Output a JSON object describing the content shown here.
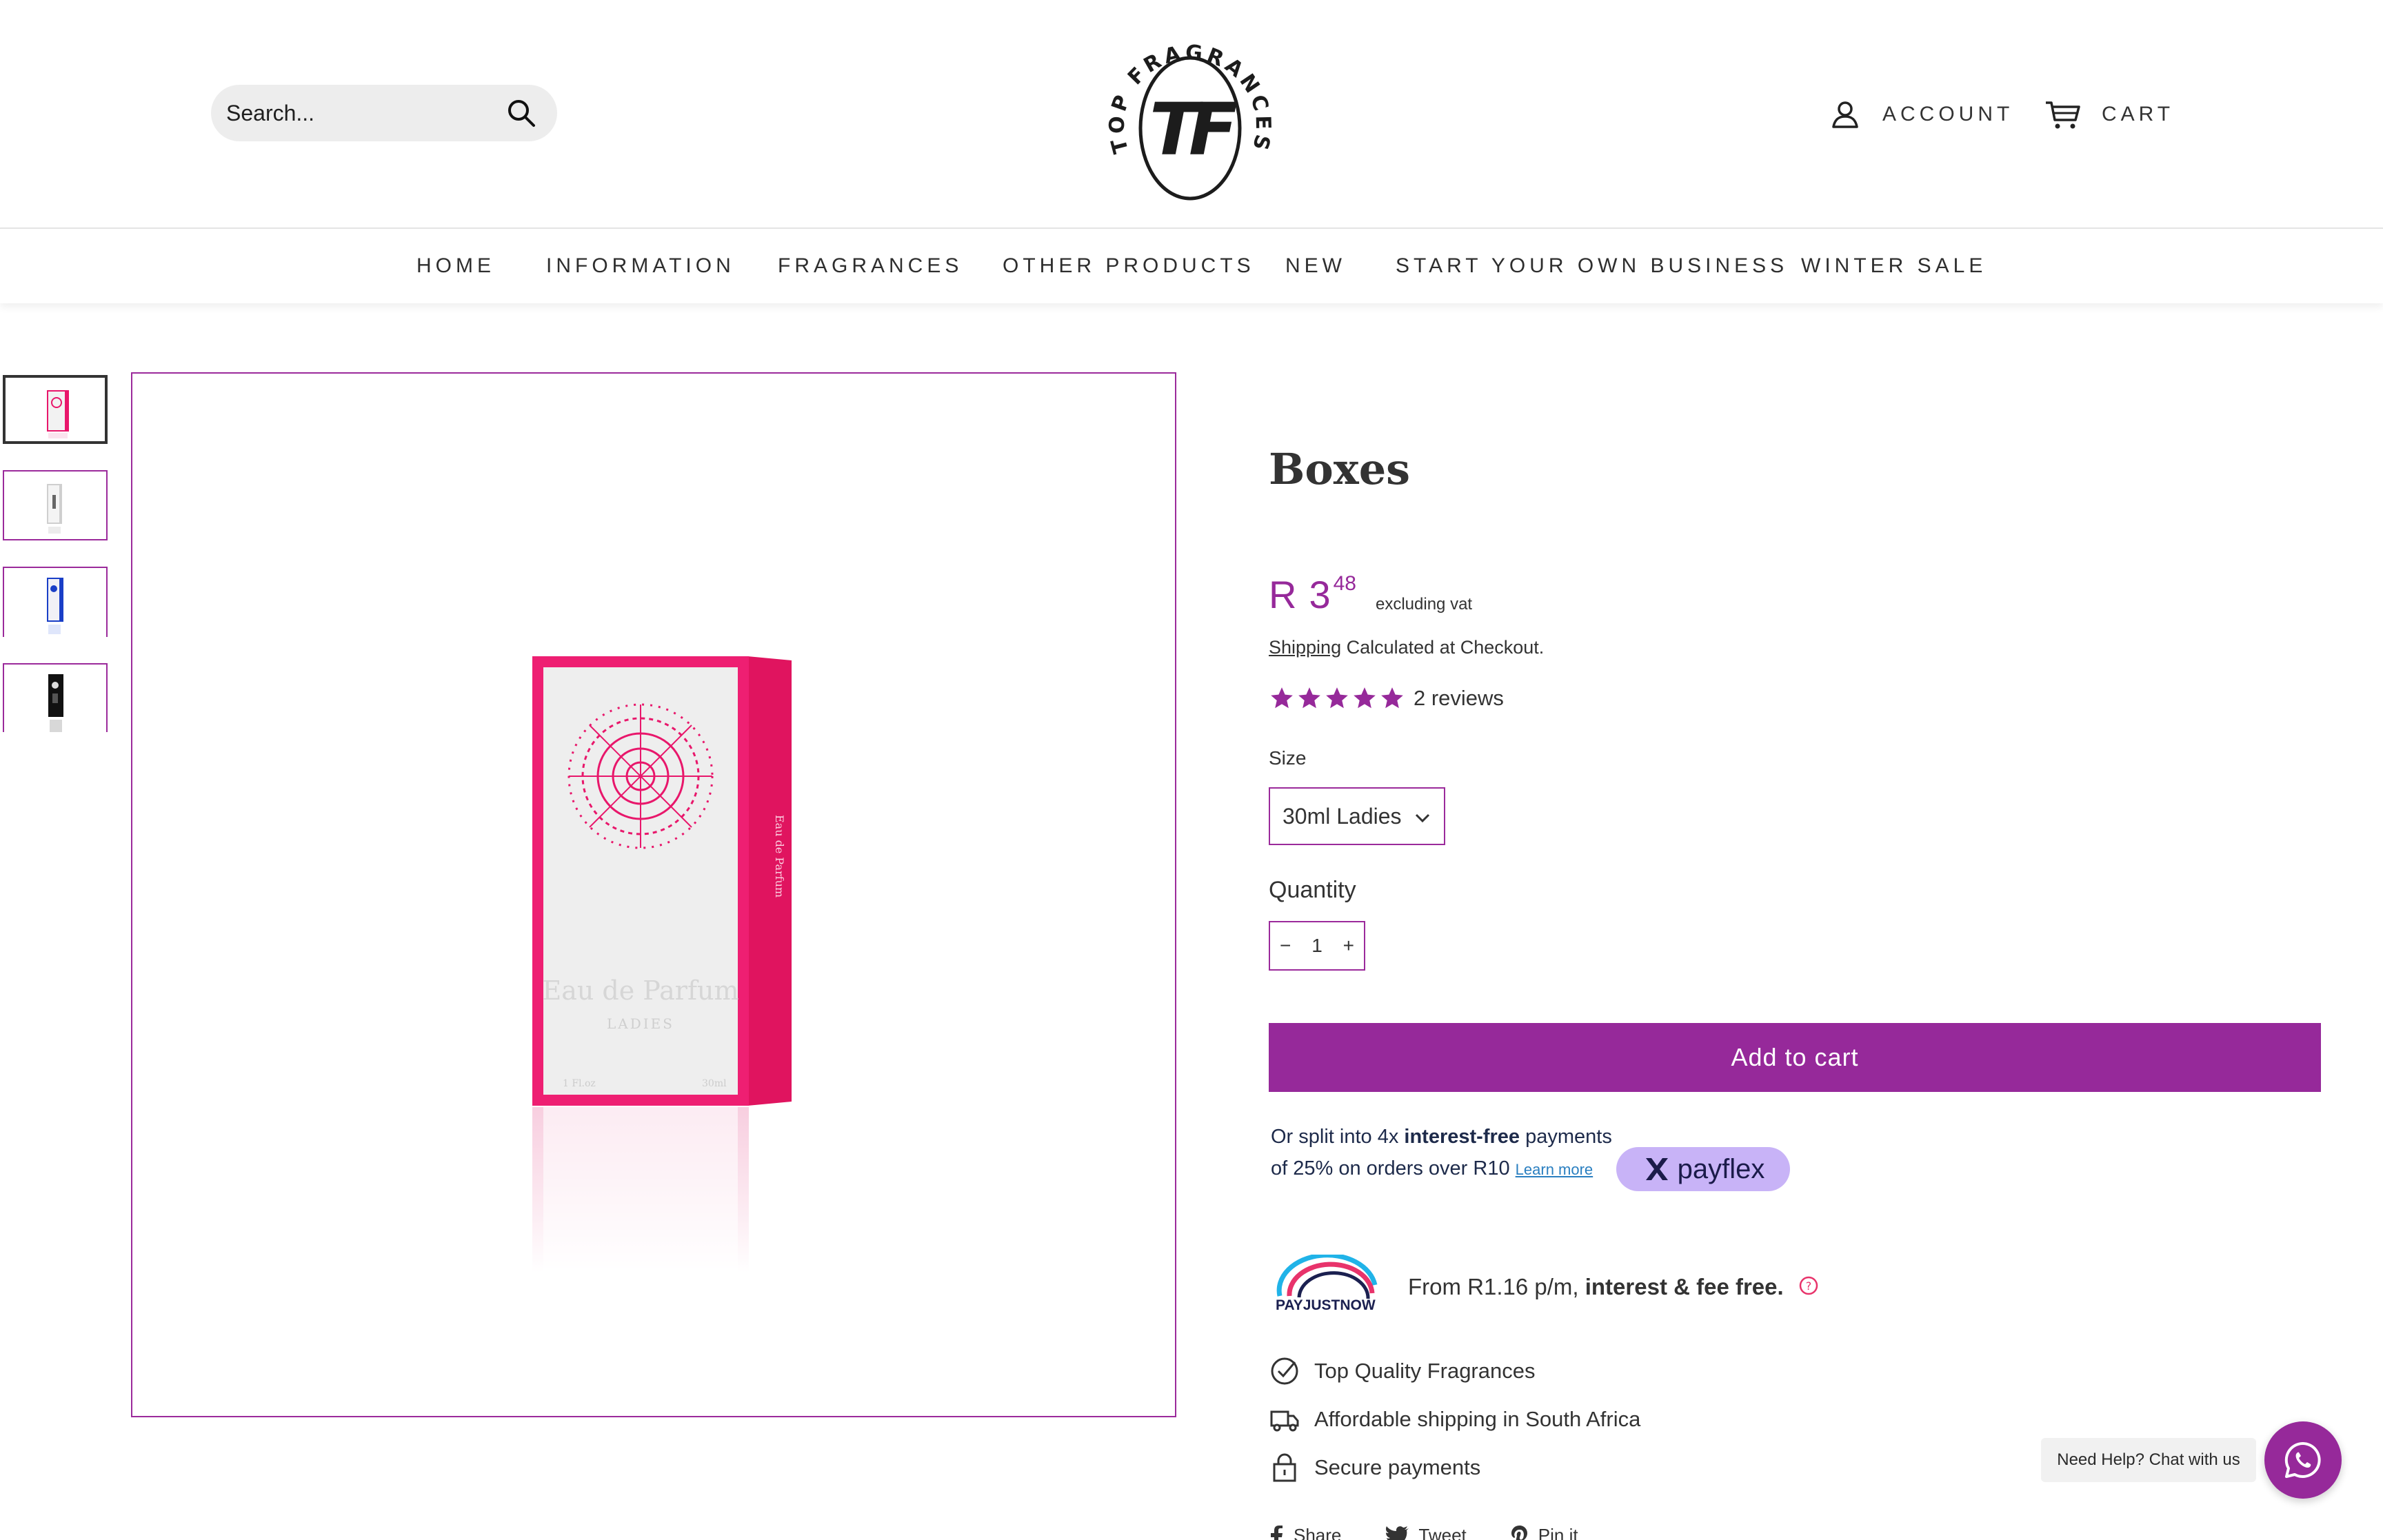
{
  "header": {
    "search_placeholder": "Search...",
    "logo_text": "TOP FRAGRANCES",
    "logo_monogram": "TF",
    "account_label": "ACCOUNT",
    "cart_label": "CART"
  },
  "nav": {
    "items": [
      {
        "label": "HOME"
      },
      {
        "label": "INFORMATION"
      },
      {
        "label": "FRAGRANCES"
      },
      {
        "label": "OTHER PRODUCTS"
      },
      {
        "label": "NEW"
      },
      {
        "label": "START YOUR OWN BUSINESS"
      },
      {
        "label": "WINTER SALE"
      }
    ]
  },
  "gallery": {
    "thumbnails": [
      {
        "name": "pink-box",
        "active": true
      },
      {
        "name": "grey-box",
        "active": false
      },
      {
        "name": "blue-box",
        "active": false
      },
      {
        "name": "black-box",
        "active": false
      }
    ],
    "box_text": "Eau de Parfum",
    "box_subtext": "LADIES",
    "box_side_text": "Eau de Parfum",
    "box_volume_left": "1 Fl.oz",
    "box_volume_right": "30ml"
  },
  "product": {
    "title": "Boxes",
    "currency": "R",
    "price_whole": "3",
    "price_cents": "48",
    "price_note": "excluding vat",
    "shipping_link": "Shipping",
    "shipping_text": "Calculated at Checkout.",
    "rating_stars": 5,
    "reviews_label": "2 reviews",
    "size_label": "Size",
    "size_value": "30ml Ladies",
    "quantity_label": "Quantity",
    "quantity_value": "1",
    "qty_minus": "−",
    "qty_plus": "+",
    "add_to_cart": "Add to cart"
  },
  "payflex": {
    "text_1": "Or split into 4x ",
    "text_bold": "interest-free",
    "text_2": " payments of 25% on orders over R10 ",
    "learn_more": "Learn more",
    "badge_label": "payflex"
  },
  "payjustnow": {
    "logo_label": "PAYJUSTNOW",
    "text_1": "From R1.16 p/m, ",
    "text_bold": "interest & fee free."
  },
  "features": [
    {
      "icon": "check-circle-icon",
      "label": "Top Quality Fragrances"
    },
    {
      "icon": "truck-icon",
      "label": "Affordable shipping in South Africa"
    },
    {
      "icon": "lock-icon",
      "label": "Secure payments"
    }
  ],
  "share": {
    "share_label": "Share",
    "tweet_label": "Tweet",
    "pin_label": "Pin it"
  },
  "chat": {
    "bubble_text": "Need Help? Chat with us"
  },
  "colors": {
    "accent": "#96299a",
    "payflex_badge": "#c8b3f7",
    "box_pink": "#e8176b"
  }
}
